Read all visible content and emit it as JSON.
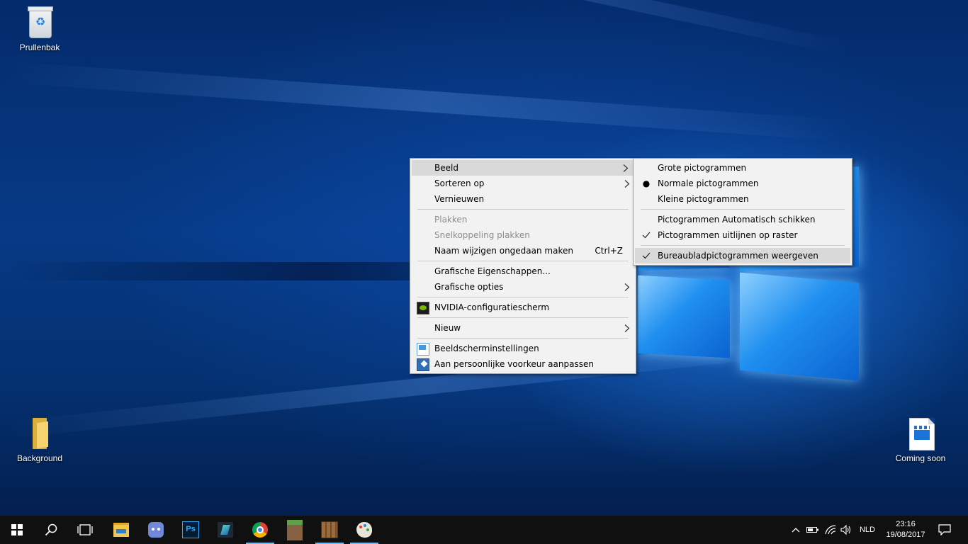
{
  "desktop": {
    "icons": [
      {
        "label": "Prullenbak",
        "icon": "recycle-bin-icon"
      },
      {
        "label": "Background",
        "icon": "folder-icon"
      },
      {
        "label": "Coming soon",
        "icon": "video-file-icon"
      }
    ]
  },
  "context_menu": {
    "items": [
      {
        "label": "Beeld",
        "has_submenu": true,
        "highlighted": true
      },
      {
        "label": "Sorteren op",
        "has_submenu": true
      },
      {
        "label": "Vernieuwen"
      },
      {
        "label": "Plakken",
        "disabled": true
      },
      {
        "label": "Snelkoppeling plakken",
        "disabled": true
      },
      {
        "label": "Naam wijzigen ongedaan maken",
        "shortcut": "Ctrl+Z"
      },
      {
        "label": "Grafische Eigenschappen..."
      },
      {
        "label": "Grafische opties",
        "has_submenu": true
      },
      {
        "label": "NVIDIA-configuratiescherm",
        "icon": "nvidia-icon"
      },
      {
        "label": "Nieuw",
        "has_submenu": true
      },
      {
        "label": "Beeldscherminstellingen",
        "icon": "display-settings-icon"
      },
      {
        "label": "Aan persoonlijke voorkeur aanpassen",
        "icon": "personalize-icon"
      }
    ]
  },
  "submenu": {
    "items": [
      {
        "label": "Grote pictogrammen"
      },
      {
        "label": "Normale pictogrammen",
        "selected": true
      },
      {
        "label": "Kleine pictogrammen"
      },
      {
        "label": "Pictogrammen Automatisch schikken"
      },
      {
        "label": "Pictogrammen uitlijnen op raster",
        "checked": true
      },
      {
        "label": "Bureaubladpictogrammen weergeven",
        "checked": true,
        "highlighted": true
      }
    ]
  },
  "taskbar": {
    "buttons": [
      "start-icon",
      "search-icon",
      "task-view-icon",
      "file-explorer-icon",
      "discord-icon",
      "photoshop-icon",
      "filmora-icon",
      "chrome-icon",
      "minecraft-icon",
      "crafting-table-icon",
      "paint-icon"
    ],
    "photoshop_label": "Ps",
    "language": "NLD",
    "time": "23:16",
    "date": "19/08/2017"
  },
  "colors": {
    "accent": "#76b9ed",
    "menu_bg": "#f2f2f2",
    "menu_highlight": "#d9d9d9",
    "taskbar_bg": "#101010",
    "desktop_blue": "#063a86"
  }
}
